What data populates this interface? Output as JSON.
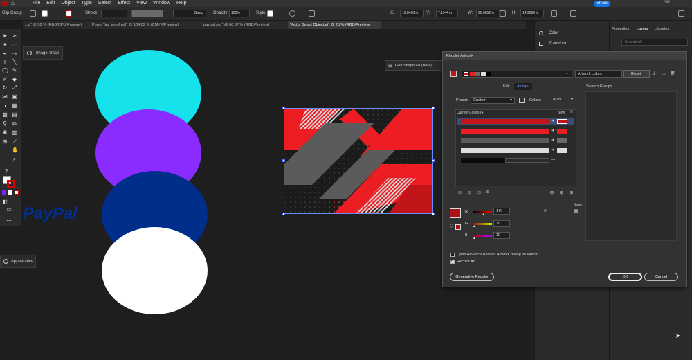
{
  "menubar": {
    "items": [
      "File",
      "Edit",
      "Object",
      "Type",
      "Select",
      "Effect",
      "View",
      "Window",
      "Help"
    ],
    "share_label": "Share",
    "user_label": "SP"
  },
  "controlbar": {
    "selection_label": "Clip Group",
    "stroke_label": "Stroke:",
    "brush_value": "Basic",
    "opacity_label": "Opacity:",
    "opacity_value": "100%",
    "style_label": "Style:",
    "x_label": "X:",
    "x_value": "10.8426 in",
    "y_label": "Y:",
    "y_value": "7.1144 in",
    "w_label": "W:",
    "w_value": "20.0852 in",
    "h_label": "H:",
    "h_value": "14.2288 in"
  },
  "tabs": [
    {
      "label": "...g* @ 50 % (RGB/CPU Preview)"
    },
    {
      "label": "PowerTag_proof.pdf* @ 104.89 % (CMYK/Preview)"
    },
    {
      "label": "paypal.svg* @ 66.67 % (RGB/Preview)"
    },
    {
      "label": "Vector Smart Object.ai* @ 25 % (RGB/Preview)"
    }
  ],
  "left_panels": {
    "image_trace_label": "Image Trace",
    "appearance_label": "Appearance"
  },
  "right_panels": {
    "color_label": "Color",
    "transform_label": "Transform",
    "tab_properties": "Properties",
    "tab_layers": "Layers",
    "tab_libraries": "Libraries",
    "search_placeholder": "Search All"
  },
  "canvas": {
    "gen_shape_fill_label": "Gen Shape Fill (Beta)",
    "paypal_text": "PayPal"
  },
  "recolor": {
    "title": "Recolor Artwork",
    "colors_field": "Artwork colors",
    "reset_label": "Reset",
    "tab_edit": "Edit",
    "tab_assign": "Assign",
    "preset_label": "Preset:",
    "preset_value": "Custom",
    "colors_label": "Colors:",
    "colors_value": "Auto",
    "current_colors_label": "Current Colors (4)",
    "new_label": "New",
    "swatch_groups_label": "Swatch Groups",
    "rows": [
      {
        "current": "#c2151a",
        "new": "#c2151a",
        "bar_fraction": 1.0
      },
      {
        "current": "#ee1c23",
        "new": "#ee1c23",
        "bar_fraction": 1.0
      },
      {
        "current": "#5b5b5b",
        "new": "#6a6a6a",
        "bar_fraction": 1.0
      },
      {
        "current": "#dcdcdc",
        "new": "#dcdcdc",
        "bar_fraction": 1.0
      },
      {
        "current": "#0b0b0b",
        "new": "",
        "bar_fraction": 0.5
      }
    ],
    "r_label": "R",
    "r_value": "170",
    "g_label": "G",
    "g_value": "19",
    "b_label": "B",
    "b_value": "19",
    "none_label": "None",
    "open_on_launch_label": "Open Advance Recolor Artwork dialog on launch",
    "recolor_art_label": "Recolor Art",
    "generative_recolor_label": "Generative Recolor",
    "ok_label": "OK",
    "cancel_label": "Cancel",
    "selected_color": "#aa1313"
  }
}
